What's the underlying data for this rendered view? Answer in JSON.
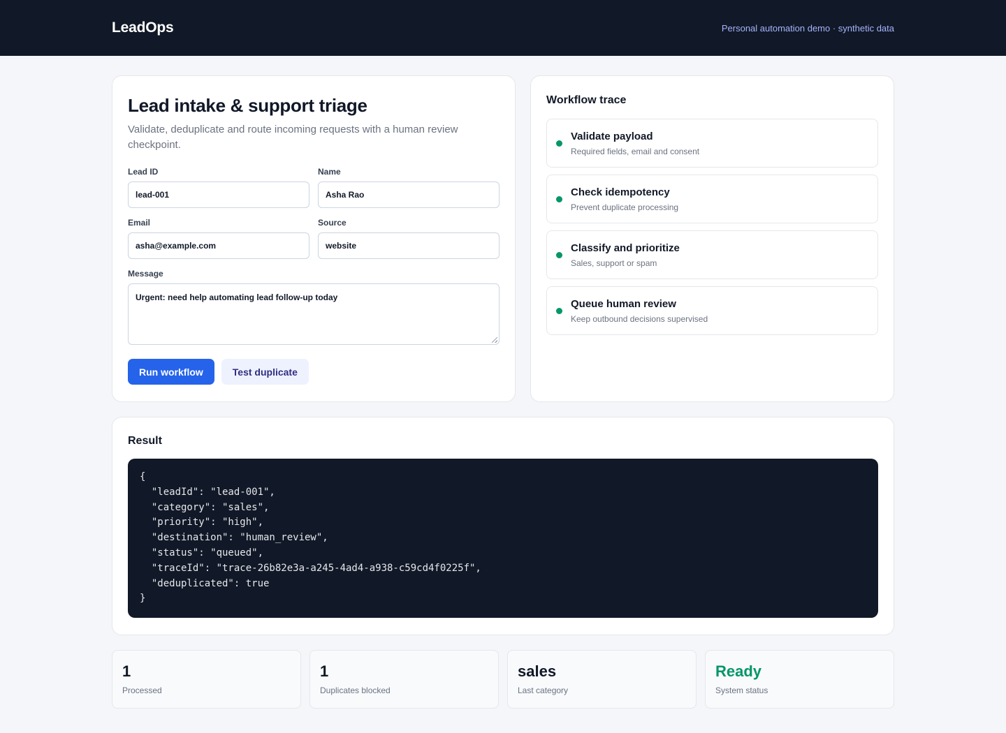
{
  "header": {
    "brand": "LeadOps",
    "tagline": "Personal automation demo · synthetic data"
  },
  "intake": {
    "title": "Lead intake & support triage",
    "subtitle": "Validate, deduplicate and route incoming requests with a human review checkpoint.",
    "fields": {
      "lead_id": {
        "label": "Lead ID",
        "value": "lead-001"
      },
      "name": {
        "label": "Name",
        "value": "Asha Rao"
      },
      "email": {
        "label": "Email",
        "value": "asha@example.com"
      },
      "source": {
        "label": "Source",
        "value": "website"
      },
      "message": {
        "label": "Message",
        "value": "Urgent: need help automating lead follow-up today"
      }
    },
    "buttons": {
      "run": "Run workflow",
      "test_duplicate": "Test duplicate"
    }
  },
  "trace": {
    "title": "Workflow trace",
    "steps": [
      {
        "title": "Validate payload",
        "desc": "Required fields, email and consent"
      },
      {
        "title": "Check idempotency",
        "desc": "Prevent duplicate processing"
      },
      {
        "title": "Classify and prioritize",
        "desc": "Sales, support or spam"
      },
      {
        "title": "Queue human review",
        "desc": "Keep outbound decisions supervised"
      }
    ]
  },
  "result": {
    "title": "Result",
    "json_text": "{\n  \"leadId\": \"lead-001\",\n  \"category\": \"sales\",\n  \"priority\": \"high\",\n  \"destination\": \"human_review\",\n  \"status\": \"queued\",\n  \"traceId\": \"trace-26b82e3a-a245-4ad4-a938-c59cd4f0225f\",\n  \"deduplicated\": true\n}"
  },
  "stats": [
    {
      "value": "1",
      "label": "Processed"
    },
    {
      "value": "1",
      "label": "Duplicates blocked"
    },
    {
      "value": "sales",
      "label": "Last category"
    },
    {
      "value": "Ready",
      "label": "System status"
    }
  ],
  "colors": {
    "accent": "#2563eb",
    "status_ok": "#059669",
    "header_bg": "#111827"
  }
}
